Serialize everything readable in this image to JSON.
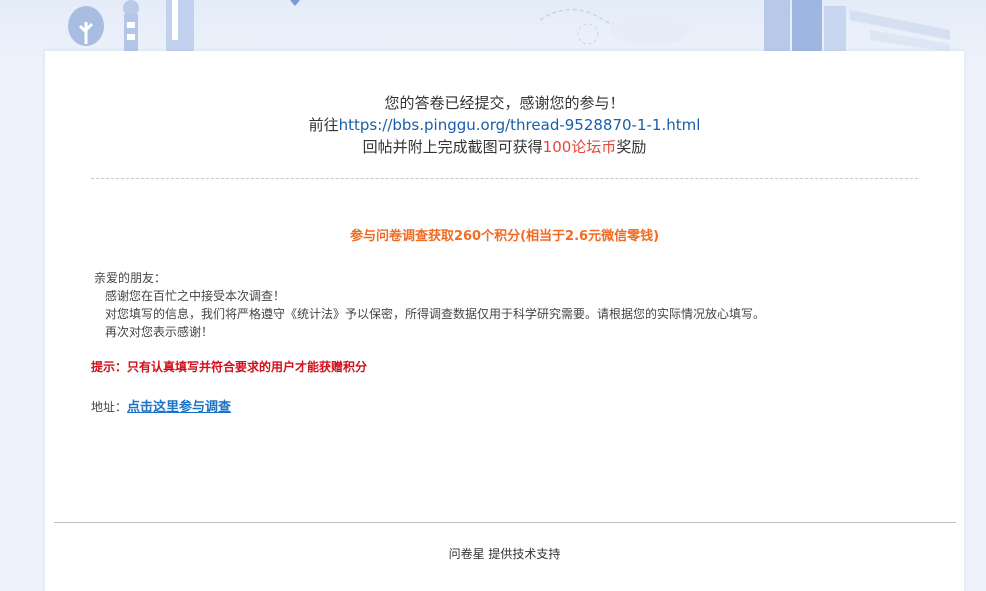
{
  "message": {
    "line1": "您的答卷已经提交，感谢您的参与！",
    "line2_prefix": "前往",
    "line2_url": "https://bbs.pinggu.org/thread-9528870-1-1.html",
    "line3_prefix": "回帖并附上完成截图可获得",
    "line3_reward": "100论坛币",
    "line3_suffix": "奖励"
  },
  "promo": "参与问卷调查获取260个积分(相当于2.6元微信零钱)",
  "letter": {
    "greeting": "亲爱的朋友：",
    "p1": "感谢您在百忙之中接受本次调查！",
    "p2": "对您填写的信息，我们将严格遵守《统计法》予以保密，所得调查数据仅用于科学研究需要。请根据您的实际情况放心填写。",
    "p3": "再次对您表示感谢！"
  },
  "tip": "提示：只有认真填写并符合要求的用户才能获赠积分",
  "address": {
    "label": "地址：",
    "link": "点击这里参与调查"
  },
  "footer": "问卷星 提供技术支持",
  "colors": {
    "accent_orange": "#f06b24",
    "tip_red": "#d0101c",
    "link_blue": "#1a73c8",
    "reward_red": "#e8463b"
  }
}
